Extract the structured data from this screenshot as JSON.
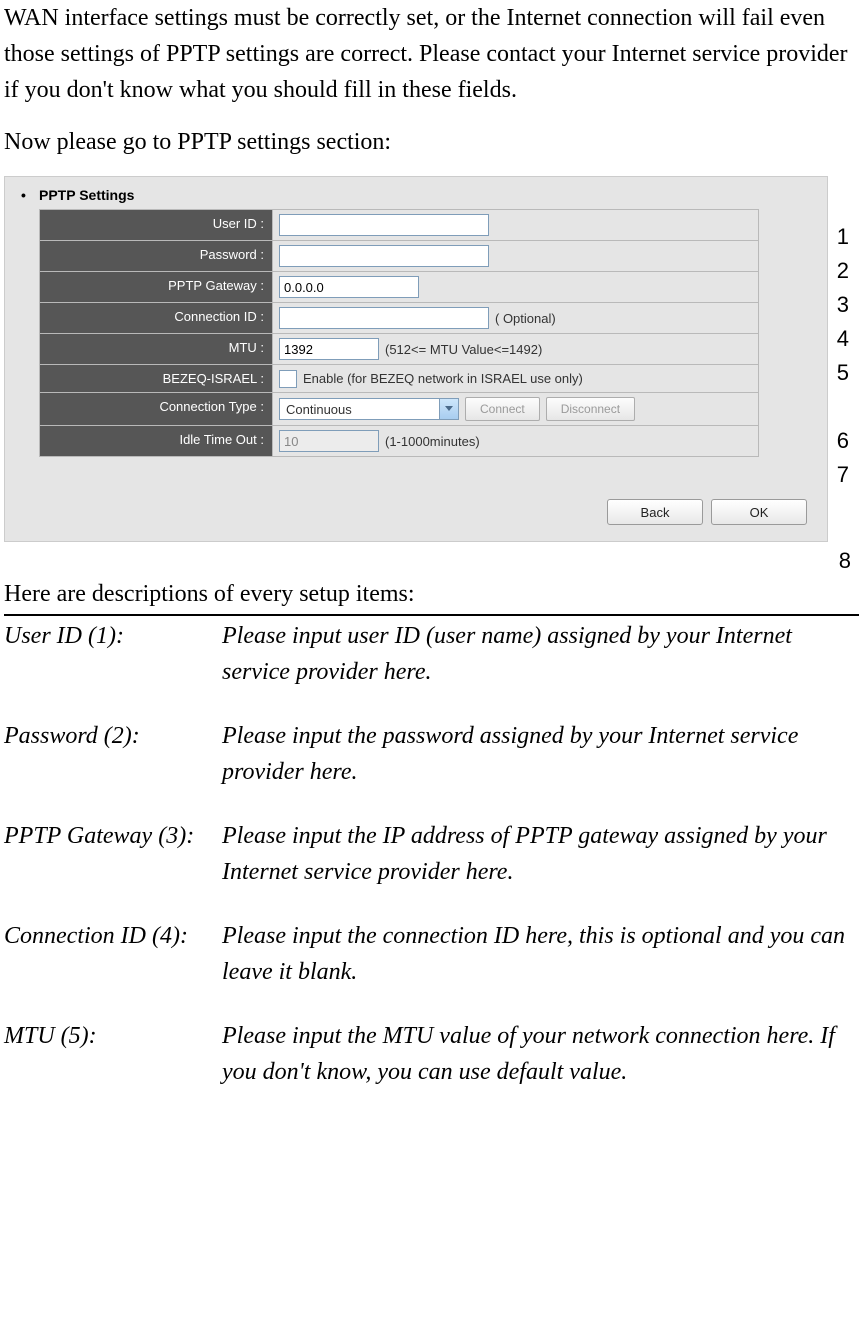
{
  "intro1": "WAN interface settings must be correctly set, or the Internet connection will fail even those settings of PPTP settings are correct. Please contact your Internet service provider if you don't know what you should fill in these fields.",
  "intro2": "Now please go to PPTP settings section:",
  "panel": {
    "title": "PPTP Settings",
    "rows": {
      "user_id": {
        "label": "User ID :",
        "value": ""
      },
      "password": {
        "label": "Password :",
        "value": ""
      },
      "gateway": {
        "label": "PPTP Gateway :",
        "value": "0.0.0.0"
      },
      "conn_id": {
        "label": "Connection ID :",
        "value": "",
        "hint": "( Optional)"
      },
      "mtu": {
        "label": "MTU :",
        "value": "1392",
        "hint": "(512<= MTU Value<=1492)"
      },
      "bezeq": {
        "label": "BEZEQ-ISRAEL :",
        "hint": "Enable (for BEZEQ network in ISRAEL use only)"
      },
      "conn_type": {
        "label": "Connection Type :",
        "value": "Continuous",
        "connect": "Connect",
        "disconnect": "Disconnect"
      },
      "idle": {
        "label": "Idle Time Out :",
        "value": "10",
        "hint": "(1-1000minutes)"
      }
    },
    "buttons": {
      "back": "Back",
      "ok": "OK"
    }
  },
  "callouts": {
    "c1": "1",
    "c2": "2",
    "c3": "3",
    "c4": "4",
    "c5": "5",
    "c6": "6",
    "c7": "7",
    "c8": "8"
  },
  "desc_intro": "Here are descriptions of every setup items:",
  "desc": [
    {
      "term": "User ID (1):",
      "body": "Please input user ID (user name) assigned by your Internet service provider here."
    },
    {
      "term": "Password (2):",
      "body": "Please input the password assigned by your Internet service provider here."
    },
    {
      "term": "PPTP Gateway (3):",
      "body": "Please input the IP address of PPTP gateway assigned by your Internet service provider here."
    },
    {
      "term": "Connection ID (4):",
      "body": "Please input the connection ID here, this is optional and you can leave it blank."
    },
    {
      "term": "MTU (5):",
      "body": "Please input the MTU value of your network connection here. If you don't know, you can use default value."
    }
  ]
}
